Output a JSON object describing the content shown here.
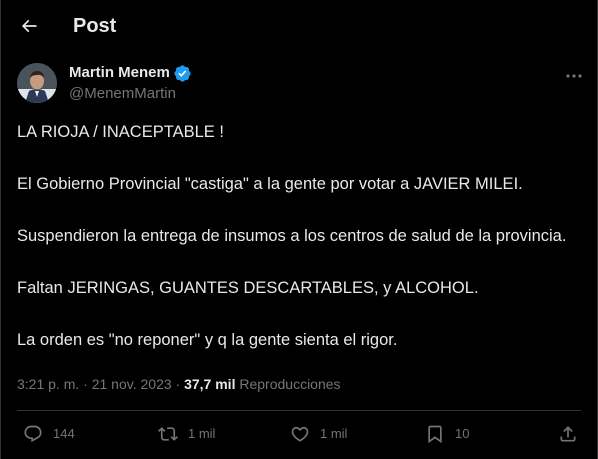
{
  "header": {
    "title": "Post",
    "back_icon": "arrow-left-icon"
  },
  "author": {
    "name": "Martin Menem",
    "handle": "@MenemMartin",
    "verified_icon": "verified-badge-icon",
    "verified_color": "#1d9bf0"
  },
  "tweet": {
    "paragraphs": [
      "LA RIOJA / INACEPTABLE !",
      "El Gobierno Provincial \"castiga\" a la gente por votar a JAVIER MILEI.",
      "Suspendieron la entrega de insumos a los centros de salud de la provincia.",
      "Faltan JERINGAS, GUANTES DESCARTABLES, y ALCOHOL.",
      "La orden es \"no reponer\" y q la gente sienta el rigor."
    ]
  },
  "meta": {
    "time": "3:21 p. m.",
    "separator": " · ",
    "date": "21 nov. 2023",
    "views_count": "37,7 mil",
    "views_label": "Reproducciones"
  },
  "actions": {
    "replies": "144",
    "reposts": "1 mil",
    "likes": "1 mil",
    "bookmarks": "10"
  },
  "colors": {
    "background": "#000000",
    "text": "#e7e9ea",
    "secondary": "#71767b",
    "border": "#2f3336"
  }
}
